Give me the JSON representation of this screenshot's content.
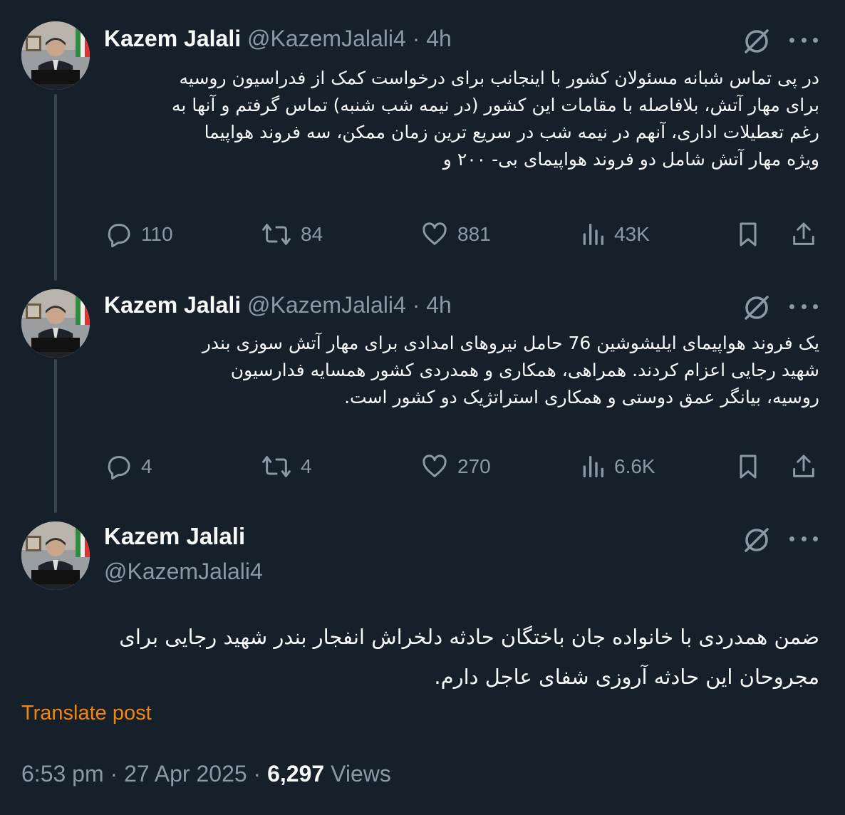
{
  "author": {
    "name": "Kazem Jalali",
    "handle": "@KazemJalali4"
  },
  "tweets": [
    {
      "time": "4h",
      "separator": "·",
      "lines": [
        "در پی تماس شبانه مسئولان کشور با اینجانب برای درخواست کمک از فدراسیون روسیه",
        "برای مهار آتش، بلافاصله با مقامات این کشور (در نیمه شب شنبه) تماس گرفتم و آنها به",
        "رغم تعطیلات اداری، آنهم در نیمه شب در سریع ترین زمان ممکن، سه فروند هواپیما",
        "ویژه مهار آتش شامل دو فروند هواپیمای بی- ۲۰۰ و"
      ],
      "replies": "110",
      "reposts": "84",
      "likes": "881",
      "views": "43K"
    },
    {
      "time": "4h",
      "separator": "·",
      "lines": [
        "یک فروند هواپیمای ایلیشوشین 76 حامل نیروهای امدادی برای مهار آتش سوزی بندر",
        "شهید رجایی اعزام کردند. همراهی، همکاری و همدردی کشور همسایه فدارسیون",
        "روسیه، بیانگر عمق دوستی و همکاری استراتژیک دو کشور است."
      ],
      "replies": "4",
      "reposts": "4",
      "likes": "270",
      "views": "6.6K"
    }
  ],
  "main_tweet": {
    "lines": [
      "ضمن همدردی با خانواده جان باختگان حادثه دلخراش انفجار بندر شهید رجایی برای",
      "مجروحان این حادثه آروزی شفای عاجل دارم."
    ],
    "translate_label": "Translate post",
    "time": "6:53 pm",
    "date": "27 Apr 2025",
    "separator": "·",
    "views_count": "6,297",
    "views_label": "Views"
  },
  "colors": {
    "background": "#15202b",
    "text": "#f7f9f9",
    "secondary": "#8b98a5",
    "accent": "#f4840f",
    "thread_line": "#38444d"
  },
  "icons": [
    "grok-icon",
    "more-icon",
    "reply-icon",
    "repost-icon",
    "like-icon",
    "views-icon",
    "bookmark-icon",
    "share-icon"
  ]
}
